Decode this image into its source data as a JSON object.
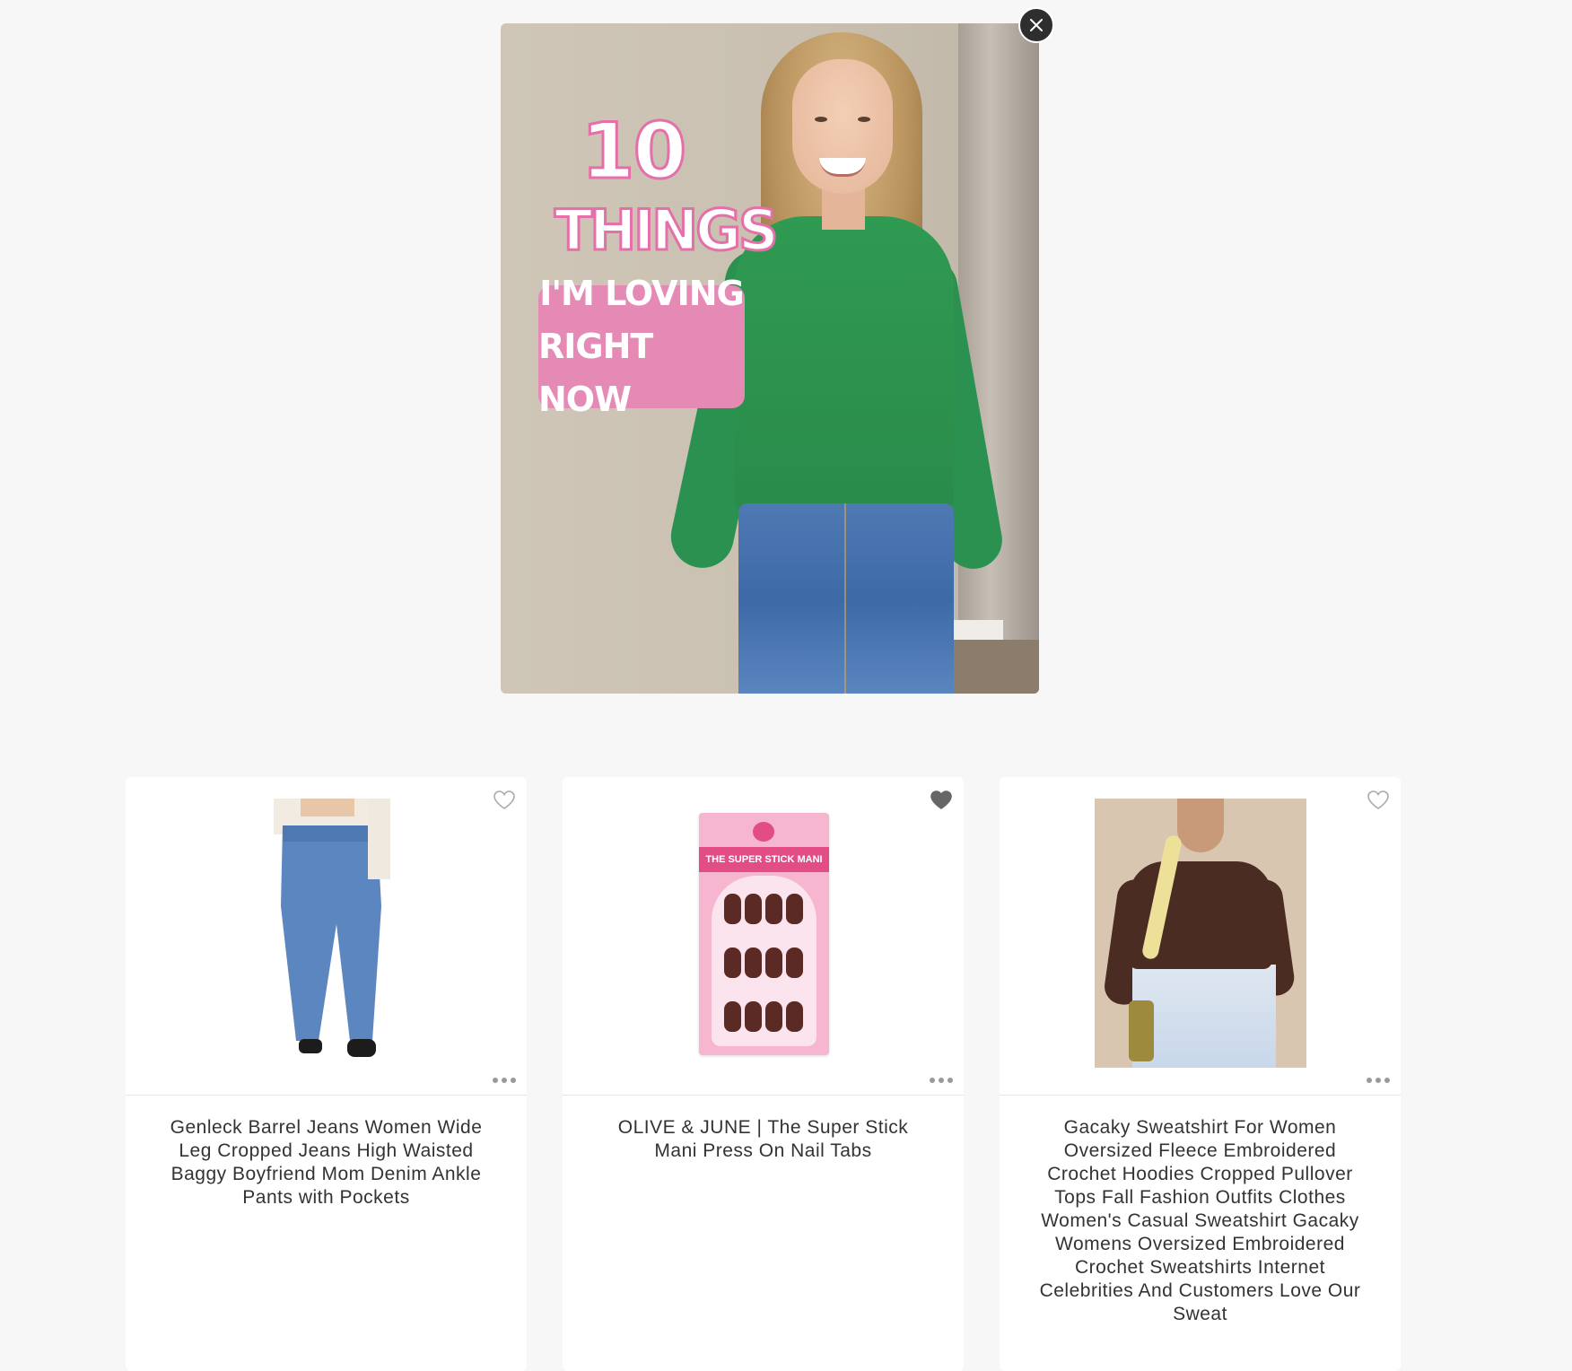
{
  "hero": {
    "overlay_number": "10",
    "overlay_word": "THINGS",
    "overlay_line1": "I'M LOVING",
    "overlay_line2": "RIGHT NOW"
  },
  "close_button": {
    "icon": "close-icon",
    "label": "Close"
  },
  "products": [
    {
      "title": "Genleck Barrel Jeans Women Wide Leg Cropped Jeans High Waisted Baggy Boyfriend Mom Denim Ankle Pants with Pockets",
      "favorited": false,
      "image": "barrel-jeans"
    },
    {
      "title": "OLIVE & JUNE | The Super Stick Mani Press On Nail Tabs",
      "favorited": true,
      "image": "press-on-nails",
      "pack_label": "THE SUPER STICK MANI"
    },
    {
      "title": "Gacaky Sweatshirt For Women Oversized Fleece Embroidered Crochet Hoodies Cropped Pullover Tops Fall Fashion Outfits Clothes Women's Casual Sweatshirt Gacaky Womens Oversized Embroidered Crochet Sweatshirts Internet Celebrities And Customers Love Our Sweat",
      "favorited": false,
      "image": "brown-sweatshirt"
    }
  ],
  "colors": {
    "page_bg": "#f7f7f7",
    "card_bg": "#ffffff",
    "overlay_pink": "#e48ab5",
    "heart_filled": "#666666",
    "heart_outline": "#aaaaaa"
  }
}
